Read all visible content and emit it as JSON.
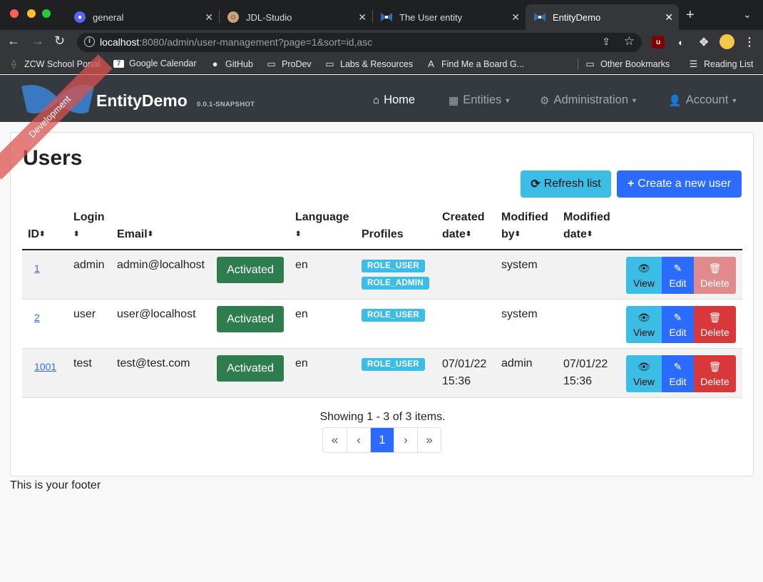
{
  "browser": {
    "tabs": [
      {
        "title": "general",
        "icon": "discord-icon"
      },
      {
        "title": "JDL-Studio",
        "icon": "jdl-icon"
      },
      {
        "title": "The User entity",
        "icon": "jhipster-icon"
      },
      {
        "title": "EntityDemo",
        "icon": "jhipster-icon",
        "active": true
      }
    ],
    "url_host": "localhost",
    "url_rest": ":8080/admin/user-management?page=1&sort=id,asc",
    "bookmarks": [
      "ZCW School Portal",
      "Google Calendar",
      "GitHub",
      "ProDev",
      "Labs & Resources",
      "Find Me a Board G...",
      "Other Bookmarks",
      "Reading List"
    ]
  },
  "app": {
    "brand": "EntityDemo",
    "version": "0.0.1-SNAPSHOT",
    "ribbon": "Development",
    "nav": {
      "home": "Home",
      "entities": "Entities",
      "administration": "Administration",
      "account": "Account"
    }
  },
  "page": {
    "title": "Users",
    "refresh_label": "Refresh list",
    "create_label": "Create a new user",
    "columns": {
      "id": "ID",
      "login": "Login",
      "email": "Email",
      "language": "Language",
      "profiles": "Profiles",
      "created_1": "Created",
      "created_2": "date",
      "modified_by_1": "Modified",
      "modified_by_2": "by",
      "modified_date_1": "Modified",
      "modified_date_2": "date"
    },
    "rows": [
      {
        "id": "1",
        "login": "admin",
        "email": "admin@localhost",
        "status": "Activated",
        "lang": "en",
        "roles": [
          "ROLE_USER",
          "ROLE_ADMIN"
        ],
        "created_date": "",
        "created_time": "",
        "modified_by": "system",
        "modified_date": "",
        "modified_time": ""
      },
      {
        "id": "2",
        "login": "user",
        "email": "user@localhost",
        "status": "Activated",
        "lang": "en",
        "roles": [
          "ROLE_USER"
        ],
        "created_date": "",
        "created_time": "",
        "modified_by": "system",
        "modified_date": "",
        "modified_time": ""
      },
      {
        "id": "1001",
        "login": "test",
        "email": "test@test.com",
        "status": "Activated",
        "lang": "en",
        "roles": [
          "ROLE_USER"
        ],
        "created_date": "07/01/22",
        "created_time": "15:36",
        "modified_by": "admin",
        "modified_date": "07/01/22",
        "modified_time": "15:36"
      }
    ],
    "actions": {
      "view": "View",
      "edit": "Edit",
      "delete": "Delete"
    },
    "showing": "Showing 1 - 3 of 3 items.",
    "pager": {
      "first": "«",
      "prev": "‹",
      "current": "1",
      "next": "›",
      "last": "»"
    }
  },
  "footer": "This is your footer",
  "colors": {
    "primary": "#2c6bff",
    "info": "#3bbde6",
    "success": "#2e7d4f",
    "danger": "#d9383a",
    "navbar": "#343a40"
  }
}
